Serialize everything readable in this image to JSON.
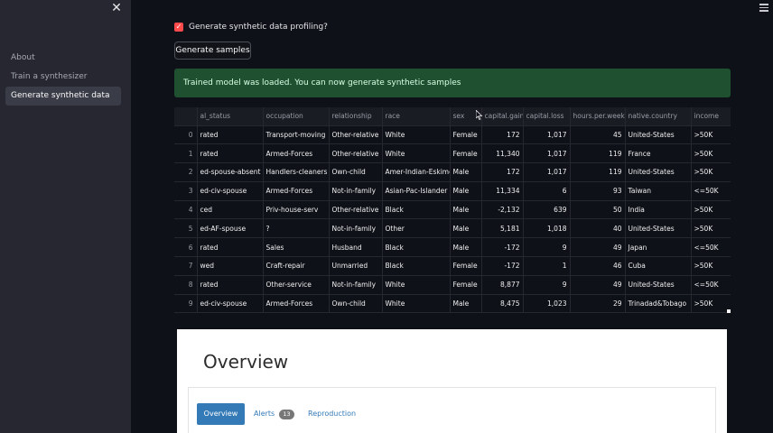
{
  "sidebar": {
    "close_icon": "close-icon",
    "items": [
      {
        "label": "About"
      },
      {
        "label": "Train a synthesizer"
      },
      {
        "label": "Generate synthetic data"
      }
    ]
  },
  "main": {
    "profiling_checkbox_label": "Generate synthetic data profiling?",
    "profiling_checked": true,
    "generate_button": "Generate samples",
    "success_message": "Trained model was loaded. You can now generate synthetic samples"
  },
  "table": {
    "columns": [
      "",
      "al_status",
      "occupation",
      "relationship",
      "race",
      "sex",
      "capital.gain",
      "capital.loss",
      "hours.per.week",
      "native.country",
      "income"
    ],
    "rows": [
      [
        "0",
        "rated",
        "Transport-moving",
        "Other-relative",
        "White",
        "Female",
        "172",
        "1,017",
        "45",
        "United-States",
        ">50K"
      ],
      [
        "1",
        "rated",
        "Armed-Forces",
        "Other-relative",
        "White",
        "Female",
        "11,340",
        "1,017",
        "119",
        "France",
        ">50K"
      ],
      [
        "2",
        "ed-spouse-absent",
        "Handlers-cleaners",
        "Own-child",
        "Amer-Indian-Eskimo",
        "Male",
        "172",
        "1,017",
        "119",
        "United-States",
        ">50K"
      ],
      [
        "3",
        "ed-civ-spouse",
        "Armed-Forces",
        "Not-in-family",
        "Asian-Pac-Islander",
        "Male",
        "11,334",
        "6",
        "93",
        "Taiwan",
        "<=50K"
      ],
      [
        "4",
        "ced",
        "Priv-house-serv",
        "Other-relative",
        "Black",
        "Male",
        "-2,132",
        "639",
        "50",
        "India",
        ">50K"
      ],
      [
        "5",
        "ed-AF-spouse",
        "?",
        "Not-in-family",
        "Other",
        "Male",
        "5,181",
        "1,018",
        "40",
        "United-States",
        ">50K"
      ],
      [
        "6",
        "rated",
        "Sales",
        "Husband",
        "Black",
        "Male",
        "-172",
        "9",
        "49",
        "Japan",
        "<=50K"
      ],
      [
        "7",
        "wed",
        "Craft-repair",
        "Unmarried",
        "Black",
        "Female",
        "-172",
        "1",
        "46",
        "Cuba",
        ">50K"
      ],
      [
        "8",
        "rated",
        "Other-service",
        "Not-in-family",
        "White",
        "Female",
        "8,877",
        "9",
        "49",
        "United-States",
        "<=50K"
      ],
      [
        "9",
        "ed-civ-spouse",
        "Armed-Forces",
        "Own-child",
        "White",
        "Male",
        "8,475",
        "1,023",
        "29",
        "Trinadad&Tobago",
        ">50K"
      ]
    ]
  },
  "report": {
    "title": "Overview",
    "tabs": {
      "overview": "Overview",
      "alerts": "Alerts",
      "alerts_count": "13",
      "reproduction": "Reproduction"
    }
  },
  "colors": {
    "background": "#0e1117",
    "sidebar": "#262730",
    "accent": "#ff4b4b",
    "success_bg": "#1f5131",
    "link": "#337ab7"
  }
}
